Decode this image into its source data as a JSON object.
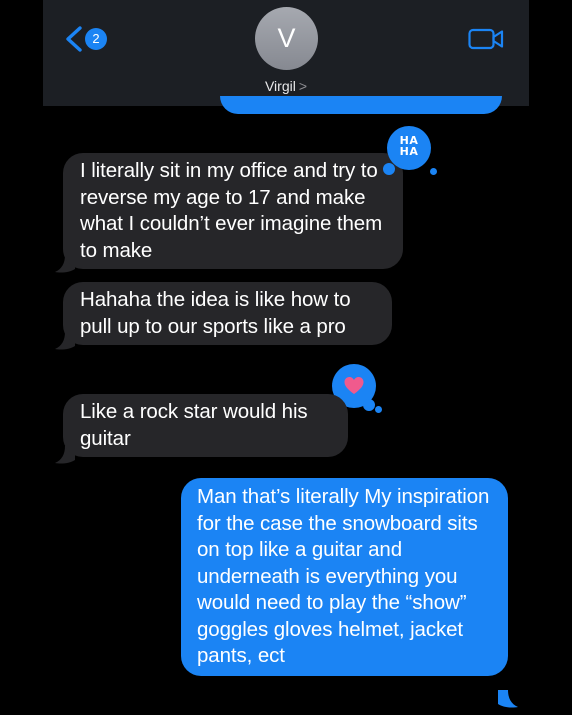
{
  "header": {
    "back_badge": "2",
    "avatar_initial": "V",
    "contact_name": "Virgil",
    "contact_chevron": ">"
  },
  "messages": [
    {
      "direction": "incoming",
      "text": "I literally sit in my office and try to reverse my age to 17 and make what I couldn’t ever imagine them to make",
      "tapback": "haha"
    },
    {
      "direction": "incoming",
      "text": "Hahaha the idea is like how to pull up to our sports like a pro"
    },
    {
      "direction": "incoming",
      "text": "Like a rock star would his guitar",
      "tapback": "heart"
    },
    {
      "direction": "outgoing",
      "text": "Man that’s literally My inspiration for the case the snowboard sits on top like a guitar and underneath is everything you would need to play the “show” goggles gloves helmet,  jacket pants, ect"
    }
  ],
  "tapbacks": {
    "haha_label": "HA HA",
    "haha_icon": "haha-reaction-icon",
    "heart_icon": "heart-reaction-icon"
  },
  "colors": {
    "outgoing_bubble": "#1b84f4",
    "incoming_bubble": "#262629",
    "header_bg": "#1c1f24",
    "heart": "#f05a8d",
    "background": "#000000"
  }
}
